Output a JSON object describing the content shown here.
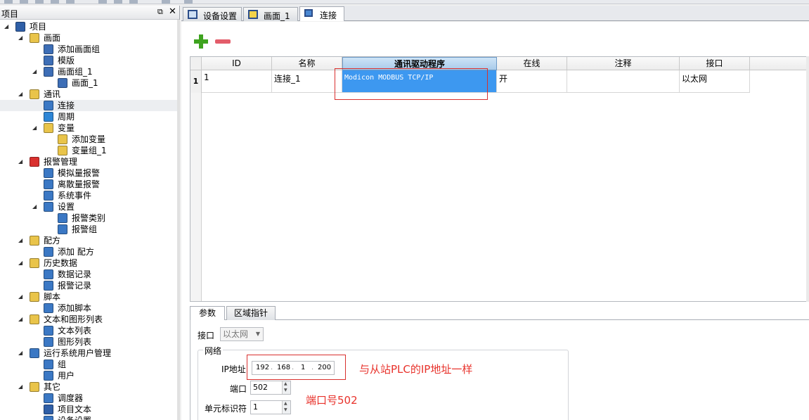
{
  "project_panel": {
    "title": "项目",
    "pin_icon": "⧉",
    "close_icon": "✕",
    "tree": [
      {
        "label": "项目",
        "icon": "factory-icon",
        "color": "#2f5fa7",
        "level": 0,
        "expanded": true
      },
      {
        "label": "画面",
        "icon": "folder-icon",
        "color": "#e9c44a",
        "level": 1,
        "expanded": true
      },
      {
        "label": "添加画面组",
        "icon": "add-screen-icon",
        "color": "#3d6eb6",
        "level": 2
      },
      {
        "label": "模版",
        "icon": "template-icon",
        "color": "#3d6eb6",
        "level": 2
      },
      {
        "label": "画面组_1",
        "icon": "screen-group-icon",
        "color": "#3d6eb6",
        "level": 2,
        "expanded": true
      },
      {
        "label": "画面_1",
        "icon": "screen-icon",
        "color": "#3d6eb6",
        "level": 3
      },
      {
        "label": "通讯",
        "icon": "comm-folder-icon",
        "color": "#e9c44a",
        "level": 1,
        "expanded": true
      },
      {
        "label": "连接",
        "icon": "connection-icon",
        "color": "#3b78c4",
        "level": 2,
        "selected": true
      },
      {
        "label": "周期",
        "icon": "cycle-icon",
        "color": "#2e86d6",
        "level": 2
      },
      {
        "label": "变量",
        "icon": "variable-icon",
        "color": "#e9c44a",
        "level": 2,
        "expanded": true
      },
      {
        "label": "添加变量",
        "icon": "add-variable-icon",
        "color": "#e9c44a",
        "level": 3
      },
      {
        "label": "变量组_1",
        "icon": "variable-group-icon",
        "color": "#e9c44a",
        "level": 3
      },
      {
        "label": "报警管理",
        "icon": "alarm-folder-icon",
        "color": "#d9302e",
        "level": 1,
        "expanded": true
      },
      {
        "label": "模拟量报警",
        "icon": "analog-alarm-icon",
        "color": "#3b78c4",
        "level": 2
      },
      {
        "label": "离散量报警",
        "icon": "discrete-alarm-icon",
        "color": "#3b78c4",
        "level": 2
      },
      {
        "label": "系统事件",
        "icon": "system-event-icon",
        "color": "#3b78c4",
        "level": 2
      },
      {
        "label": "设置",
        "icon": "settings-icon",
        "color": "#3b78c4",
        "level": 2,
        "expanded": true
      },
      {
        "label": "报警类别",
        "icon": "alarm-class-icon",
        "color": "#3b78c4",
        "level": 3
      },
      {
        "label": "报警组",
        "icon": "alarm-group-icon",
        "color": "#3b78c4",
        "level": 3
      },
      {
        "label": "配方",
        "icon": "recipe-folder-icon",
        "color": "#e9c44a",
        "level": 1,
        "expanded": true
      },
      {
        "label": "添加 配方",
        "icon": "add-recipe-icon",
        "color": "#3b78c4",
        "level": 2
      },
      {
        "label": "历史数据",
        "icon": "history-folder-icon",
        "color": "#e9c44a",
        "level": 1,
        "expanded": true
      },
      {
        "label": "数据记录",
        "icon": "data-log-icon",
        "color": "#3b78c4",
        "level": 2
      },
      {
        "label": "报警记录",
        "icon": "alarm-log-icon",
        "color": "#3b78c4",
        "level": 2
      },
      {
        "label": "脚本",
        "icon": "script-folder-icon",
        "color": "#e9c44a",
        "level": 1,
        "expanded": true
      },
      {
        "label": "添加脚本",
        "icon": "add-script-icon",
        "color": "#3b78c4",
        "level": 2
      },
      {
        "label": "文本和图形列表",
        "icon": "text-graphic-folder-icon",
        "color": "#e9c44a",
        "level": 1,
        "expanded": true
      },
      {
        "label": "文本列表",
        "icon": "text-list-icon",
        "color": "#3b78c4",
        "level": 2
      },
      {
        "label": "图形列表",
        "icon": "graphic-list-icon",
        "color": "#3b78c4",
        "level": 2
      },
      {
        "label": "运行系统用户管理",
        "icon": "user-admin-icon",
        "color": "#3b78c4",
        "level": 1,
        "expanded": true
      },
      {
        "label": "组",
        "icon": "group-icon",
        "color": "#3b78c4",
        "level": 2
      },
      {
        "label": "用户",
        "icon": "user-icon",
        "color": "#3b78c4",
        "level": 2
      },
      {
        "label": "其它",
        "icon": "other-folder-icon",
        "color": "#e9c44a",
        "level": 1,
        "expanded": true
      },
      {
        "label": "调度器",
        "icon": "scheduler-icon",
        "color": "#3b78c4",
        "level": 2
      },
      {
        "label": "项目文本",
        "icon": "project-text-icon",
        "color": "#2f5fa7",
        "level": 2
      },
      {
        "label": "设备设置",
        "icon": "device-settings-icon",
        "color": "#3b78c4",
        "level": 2
      }
    ]
  },
  "tabs": [
    {
      "label": "设备设置",
      "icon": "device-settings-icon",
      "active": false
    },
    {
      "label": "画面_1",
      "icon": "screen-icon",
      "active": false
    },
    {
      "label": "连接",
      "icon": "connection-icon",
      "active": true
    }
  ],
  "toolbar": {
    "add_icon": "plus-icon",
    "remove_icon": "minus-icon"
  },
  "grid": {
    "columns": [
      "ID",
      "名称",
      "通讯驱动程序",
      "在线",
      "注释",
      "接口"
    ],
    "selected_column": "通讯驱动程序",
    "rows": [
      {
        "row_number": "1",
        "id": "1",
        "name": "连接_1",
        "driver": "Modicon MODBUS TCP/IP",
        "online": "开",
        "comment": "",
        "interface": "以太网"
      }
    ]
  },
  "properties": {
    "tabs": [
      "参数",
      "区域指针"
    ],
    "interface_label": "接口",
    "interface_value": "以太网",
    "network_group": "网络",
    "ip_label": "IP地址",
    "ip": [
      "192",
      "168",
      "1",
      "200"
    ],
    "port_label": "端口",
    "port_value": "502",
    "unit_label": "单元标识符",
    "unit_value": "1"
  },
  "annotations": {
    "ip_note": "与从站PLC的IP地址一样",
    "port_note": "端口号502",
    "color": "#e8322b"
  }
}
